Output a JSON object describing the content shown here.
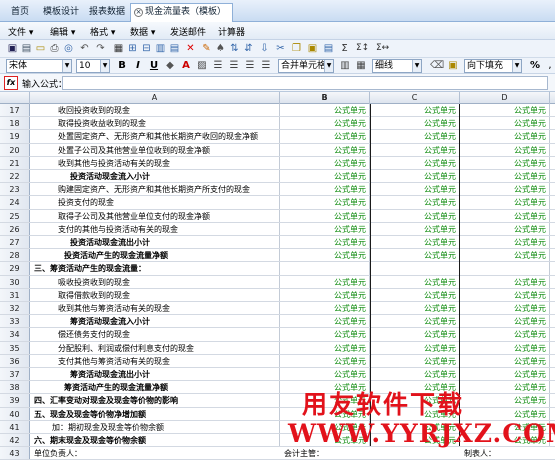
{
  "tabs": [
    {
      "label": "首页"
    },
    {
      "label": "模板设计"
    },
    {
      "label": "报表数据"
    },
    {
      "label": "现金流量表（模板）"
    }
  ],
  "menu": {
    "file": "文件",
    "edit": "编辑",
    "format": "格式",
    "data": "数据",
    "send_mail": "发送邮件",
    "calculator": "计算器"
  },
  "toolbar2": {
    "font": "宋体",
    "size": "10",
    "merge": "合并单元格",
    "line": "细线",
    "fill": "向下填充",
    "percent": "%"
  },
  "formula_bar": {
    "label": "输入公式：",
    "fx": "fx",
    "value": ""
  },
  "columns": [
    "A",
    "B",
    "C",
    "D"
  ],
  "rows": [
    {
      "n": "17",
      "a": "收回投资收到的现金",
      "b": "公式单元",
      "c": "公式单元",
      "d": "公式单元",
      "indent": 2,
      "bold": false
    },
    {
      "n": "18",
      "a": "取得投资收益收到的现金",
      "b": "公式单元",
      "c": "公式单元",
      "d": "公式单元",
      "indent": 2,
      "bold": false
    },
    {
      "n": "19",
      "a": "处置固定资产、无形资产和其他长期资产收回的现金净额",
      "b": "公式单元",
      "c": "公式单元",
      "d": "公式单元",
      "indent": 2,
      "bold": false
    },
    {
      "n": "20",
      "a": "处置子公司及其他营业单位收到的现金净额",
      "b": "公式单元",
      "c": "公式单元",
      "d": "公式单元",
      "indent": 2,
      "bold": false
    },
    {
      "n": "21",
      "a": "收到其他与投资活动有关的现金",
      "b": "公式单元",
      "c": "公式单元",
      "d": "公式单元",
      "indent": 2,
      "bold": false
    },
    {
      "n": "22",
      "a": "投资活动现金流入小计",
      "b": "公式单元",
      "c": "公式单元",
      "d": "公式单元",
      "indent": 3,
      "bold": true
    },
    {
      "n": "23",
      "a": "购建固定资产、无形资产和其他长期资产所支付的现金",
      "b": "公式单元",
      "c": "公式单元",
      "d": "公式单元",
      "indent": 2,
      "bold": false
    },
    {
      "n": "24",
      "a": "投资支付的现金",
      "b": "公式单元",
      "c": "公式单元",
      "d": "公式单元",
      "indent": 2,
      "bold": false
    },
    {
      "n": "25",
      "a": "取得子公司及其他营业单位支付的现金净额",
      "b": "公式单元",
      "c": "公式单元",
      "d": "公式单元",
      "indent": 2,
      "bold": false
    },
    {
      "n": "26",
      "a": "支付的其他与投资活动有关的现金",
      "b": "公式单元",
      "c": "公式单元",
      "d": "公式单元",
      "indent": 2,
      "bold": false
    },
    {
      "n": "27",
      "a": "投资活动现金流出小计",
      "b": "公式单元",
      "c": "公式单元",
      "d": "公式单元",
      "indent": 3,
      "bold": true
    },
    {
      "n": "28",
      "a": "投资活动产生的现金流量净额",
      "b": "公式单元",
      "c": "公式单元",
      "d": "公式单元",
      "indent": 2.5,
      "bold": true
    },
    {
      "n": "29",
      "a": "三、筹资活动产生的现金流量：",
      "b": "",
      "c": "",
      "d": "",
      "indent": 0,
      "bold": true
    },
    {
      "n": "30",
      "a": "吸收投资收到的现金",
      "b": "公式单元",
      "c": "公式单元",
      "d": "公式单元",
      "indent": 2,
      "bold": false
    },
    {
      "n": "31",
      "a": "取得借款收到的现金",
      "b": "公式单元",
      "c": "公式单元",
      "d": "公式单元",
      "indent": 2,
      "bold": false
    },
    {
      "n": "32",
      "a": "收到其他与筹资活动有关的现金",
      "b": "公式单元",
      "c": "公式单元",
      "d": "公式单元",
      "indent": 2,
      "bold": false
    },
    {
      "n": "33",
      "a": "筹资活动现金流入小计",
      "b": "公式单元",
      "c": "公式单元",
      "d": "公式单元",
      "indent": 3,
      "bold": true
    },
    {
      "n": "34",
      "a": "偿还债务支付的现金",
      "b": "公式单元",
      "c": "公式单元",
      "d": "公式单元",
      "indent": 2,
      "bold": false
    },
    {
      "n": "35",
      "a": "分配股利、利润或偿付利息支付的现金",
      "b": "公式单元",
      "c": "公式单元",
      "d": "公式单元",
      "indent": 2,
      "bold": false
    },
    {
      "n": "36",
      "a": "支付其他与筹资活动有关的现金",
      "b": "公式单元",
      "c": "公式单元",
      "d": "公式单元",
      "indent": 2,
      "bold": false
    },
    {
      "n": "37",
      "a": "筹资活动现金流出小计",
      "b": "公式单元",
      "c": "公式单元",
      "d": "公式单元",
      "indent": 3,
      "bold": true
    },
    {
      "n": "38",
      "a": "筹资活动产生的现金流量净额",
      "b": "公式单元",
      "c": "公式单元",
      "d": "公式单元",
      "indent": 2.5,
      "bold": true
    },
    {
      "n": "39",
      "a": "四、汇率变动对现金及现金等价物的影响",
      "b": "公式单元",
      "c": "公式单元",
      "d": "公式单元",
      "indent": 0,
      "bold": true
    },
    {
      "n": "40",
      "a": "五、现金及现金等价物净增加额",
      "b": "公式单元",
      "c": "公式单元",
      "d": "公式单元",
      "indent": 0,
      "bold": true
    },
    {
      "n": "41",
      "a": "加：期初现金及现金等价物余额",
      "b": "公式单元",
      "c": "公式单元",
      "d": "公式单元",
      "indent": 1.5,
      "bold": false
    },
    {
      "n": "42",
      "a": "六、期末现金及现金等价物余额",
      "b": "公式单元",
      "c": "公式单元",
      "d": "公式单元",
      "indent": 0,
      "bold": true
    },
    {
      "n": "43",
      "a": "单位负责人：",
      "b": "会计主管：",
      "c": "",
      "d": "制表人：",
      "indent": 0,
      "bold": false,
      "footer": true
    }
  ],
  "watermark": {
    "line1": "用友软件下载",
    "line2": "WWW.YYRJXZ.COM"
  },
  "colors": {
    "formula_cell": "#0a8a0a",
    "watermark": "#e2121b",
    "header_bg": "#dde4ee"
  }
}
